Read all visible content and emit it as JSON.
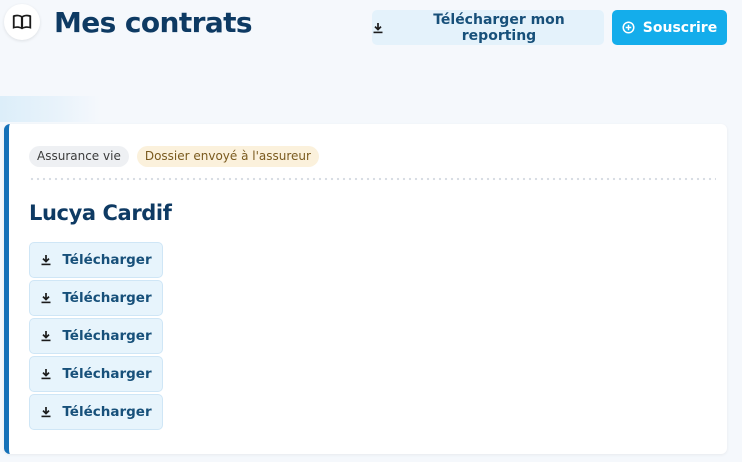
{
  "header": {
    "title": "Mes contrats",
    "book_icon": "open-book-icon",
    "report_button_label": "Télécharger mon reporting",
    "report_button_icon": "download-icon",
    "subscribe_button_label": "Souscrire",
    "subscribe_button_icon": "plus-circle-icon"
  },
  "contract": {
    "type_badge": "Assurance vie",
    "status_badge": "Dossier envoyé à l'assureur",
    "name": "Lucya Cardif",
    "downloads": [
      {
        "label": "Télécharger",
        "icon": "download-icon"
      },
      {
        "label": "Télécharger",
        "icon": "download-icon"
      },
      {
        "label": "Télécharger",
        "icon": "download-icon"
      },
      {
        "label": "Télécharger",
        "icon": "download-icon"
      },
      {
        "label": "Télécharger",
        "icon": "download-icon"
      }
    ]
  },
  "colors": {
    "title": "#0e3a63",
    "accent": "#14adeb",
    "card_accent": "#1571b8",
    "button_light_bg": "#e4f2fb",
    "status_badge_bg": "#fbf1dc"
  }
}
